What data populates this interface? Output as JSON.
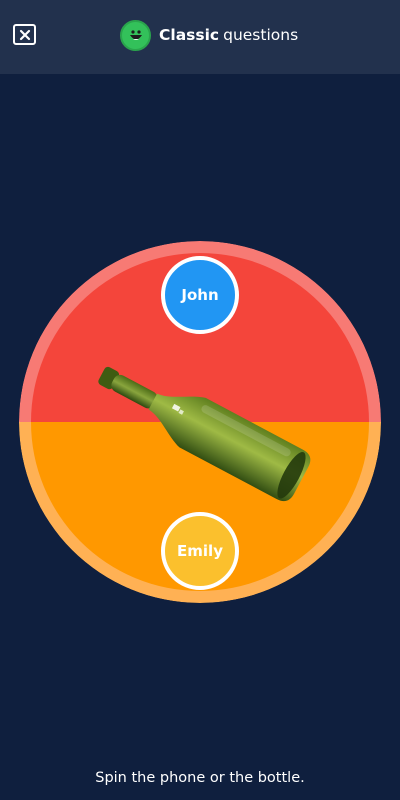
{
  "header": {
    "title_bold": "Classic",
    "title_rest": "questions",
    "close_icon": "close-icon",
    "logo_icon": "smiley-logo-icon"
  },
  "wheel": {
    "players": [
      {
        "name": "John",
        "color": "#2196f3"
      },
      {
        "name": "Emily",
        "color": "#fbc02d"
      }
    ],
    "top_color": "#f4453b",
    "bottom_color": "#ff9800",
    "bottle_icon": "bottle-icon"
  },
  "footer": {
    "instruction": "Spin the phone or the bottle."
  },
  "colors": {
    "background": "#0f1f3e",
    "header": "#22314d",
    "logo": "#33c15a"
  }
}
